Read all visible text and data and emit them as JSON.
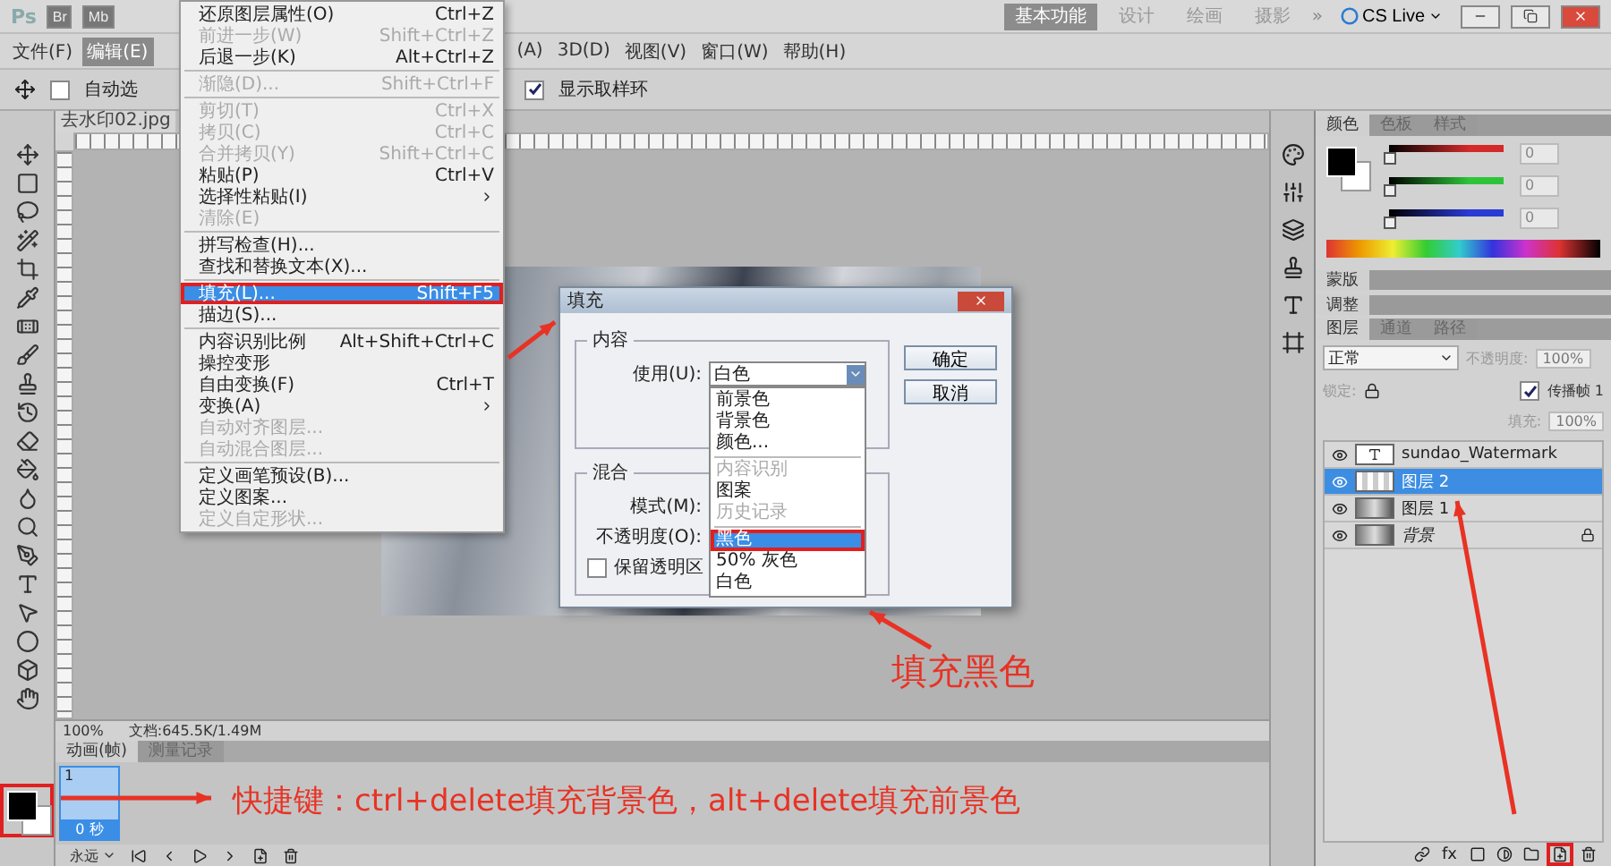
{
  "title_bar": {
    "logo": "Ps",
    "apps": [
      "Br",
      "Mb"
    ],
    "workspaces": [
      {
        "label": "基本功能",
        "selected": true
      },
      {
        "label": "设计",
        "selected": false
      },
      {
        "label": "绘画",
        "selected": false
      },
      {
        "label": "摄影",
        "selected": false
      }
    ],
    "more": "»",
    "cs_live": "CS Live"
  },
  "menu_bar": [
    {
      "label": "文件(F)",
      "selected": false
    },
    {
      "label": "编辑(E)",
      "selected": true
    },
    {
      "label": "(A)",
      "selected": false
    },
    {
      "label": "3D(D)",
      "selected": false
    },
    {
      "label": "视图(V)",
      "selected": false
    },
    {
      "label": "窗口(W)",
      "selected": false
    },
    {
      "label": "帮助(H)",
      "selected": false
    }
  ],
  "options_bar": {
    "auto_select": {
      "label": "自动选",
      "checked": false
    },
    "show_ring": {
      "label": "显示取样环",
      "checked": true
    }
  },
  "document": {
    "tab": "去水印02.jpg",
    "zoom": "100%",
    "doc_info": "文档:645.5K/1.49M"
  },
  "edit_menu": {
    "groups": [
      [
        {
          "label": "还原图层属性(O)",
          "shortcut": "Ctrl+Z",
          "disabled": false,
          "selected": false,
          "submenu": false
        },
        {
          "label": "前进一步(W)",
          "shortcut": "Shift+Ctrl+Z",
          "disabled": true,
          "selected": false,
          "submenu": false
        },
        {
          "label": "后退一步(K)",
          "shortcut": "Alt+Ctrl+Z",
          "disabled": false,
          "selected": false,
          "submenu": false
        }
      ],
      [
        {
          "label": "渐隐(D)...",
          "shortcut": "Shift+Ctrl+F",
          "disabled": true,
          "selected": false,
          "submenu": false
        }
      ],
      [
        {
          "label": "剪切(T)",
          "shortcut": "Ctrl+X",
          "disabled": true,
          "selected": false,
          "submenu": false
        },
        {
          "label": "拷贝(C)",
          "shortcut": "Ctrl+C",
          "disabled": true,
          "selected": false,
          "submenu": false
        },
        {
          "label": "合并拷贝(Y)",
          "shortcut": "Shift+Ctrl+C",
          "disabled": true,
          "selected": false,
          "submenu": false
        },
        {
          "label": "粘贴(P)",
          "shortcut": "Ctrl+V",
          "disabled": false,
          "selected": false,
          "submenu": false
        },
        {
          "label": "选择性粘贴(I)",
          "disabled": false,
          "selected": false,
          "submenu": true
        },
        {
          "label": "清除(E)",
          "disabled": true,
          "selected": false,
          "submenu": false
        }
      ],
      [
        {
          "label": "拼写检查(H)...",
          "disabled": false,
          "selected": false,
          "submenu": false
        },
        {
          "label": "查找和替换文本(X)...",
          "disabled": false,
          "selected": false,
          "submenu": false
        }
      ],
      [
        {
          "label": "填充(L)...",
          "shortcut": "Shift+F5",
          "disabled": false,
          "selected": true,
          "submenu": false
        },
        {
          "label": "描边(S)...",
          "disabled": false,
          "selected": false,
          "submenu": false
        }
      ],
      [
        {
          "label": "内容识别比例",
          "shortcut": "Alt+Shift+Ctrl+C",
          "disabled": false,
          "selected": false,
          "submenu": false
        },
        {
          "label": "操控变形",
          "disabled": false,
          "selected": false,
          "submenu": false
        },
        {
          "label": "自由变换(F)",
          "shortcut": "Ctrl+T",
          "disabled": false,
          "selected": false,
          "submenu": false
        },
        {
          "label": "变换(A)",
          "disabled": false,
          "selected": false,
          "submenu": true
        },
        {
          "label": "自动对齐图层...",
          "disabled": true,
          "selected": false,
          "submenu": false
        },
        {
          "label": "自动混合图层...",
          "disabled": true,
          "selected": false,
          "submenu": false
        }
      ],
      [
        {
          "label": "定义画笔预设(B)...",
          "disabled": false,
          "selected": false,
          "submenu": false
        },
        {
          "label": "定义图案...",
          "disabled": false,
          "selected": false,
          "submenu": false
        },
        {
          "label": "定义自定形状...",
          "disabled": true,
          "selected": false,
          "submenu": false
        }
      ]
    ]
  },
  "fill_dialog": {
    "title": "填充",
    "contents_label": "内容",
    "use_label": "使用(U):",
    "use_value": "白色",
    "options": [
      [
        {
          "label": "前景色",
          "disabled": false,
          "selected": false
        },
        {
          "label": "背景色",
          "disabled": false,
          "selected": false
        },
        {
          "label": "颜色...",
          "disabled": false,
          "selected": false
        }
      ],
      [
        {
          "label": "内容识别",
          "disabled": true,
          "selected": false
        },
        {
          "label": "图案",
          "disabled": false,
          "selected": false
        },
        {
          "label": "历史记录",
          "disabled": true,
          "selected": false
        }
      ],
      [
        {
          "label": "黑色",
          "disabled": false,
          "selected": true
        },
        {
          "label": "50% 灰色",
          "disabled": false,
          "selected": false
        },
        {
          "label": "白色",
          "disabled": false,
          "selected": false
        }
      ]
    ],
    "blend_label": "混合",
    "mode_label": "模式(M):",
    "opacity_label": "不透明度(O):",
    "preserve": {
      "label": "保留透明区",
      "checked": false
    },
    "buttons": [
      "确定",
      "取消"
    ]
  },
  "color_panel": {
    "tabs": [
      {
        "label": "颜色",
        "selected": true
      },
      {
        "label": "色板",
        "selected": false
      },
      {
        "label": "样式",
        "selected": false
      }
    ],
    "channels": [
      {
        "color": "#d42a2a",
        "level": 0,
        "value": "0"
      },
      {
        "color": "#2ec43a",
        "level": 0,
        "value": "0"
      },
      {
        "color": "#2a3ad4",
        "level": 0,
        "value": "0"
      }
    ]
  },
  "collapsed_panels": [
    "蒙版",
    "调整"
  ],
  "layers_panel": {
    "tabs": [
      {
        "label": "图层",
        "selected": true
      },
      {
        "label": "通道",
        "selected": false
      },
      {
        "label": "路径",
        "selected": false
      }
    ],
    "blend_mode": "正常",
    "opacity_label": "不透明度:",
    "opacity": "100%",
    "lock_label": "锁定:",
    "propagate": {
      "label": "传播帧 1",
      "checked": true
    },
    "fill_label": "填充:",
    "fill": "100%",
    "layers": [
      {
        "name": "sundao_Watermark",
        "kind": "text",
        "selected": false,
        "locked": false
      },
      {
        "name": "图层 2",
        "kind": "empty",
        "selected": true,
        "locked": false
      },
      {
        "name": "图层 1",
        "kind": "image",
        "selected": false,
        "locked": false
      },
      {
        "name": "背景",
        "kind": "image",
        "selected": false,
        "locked": true
      }
    ],
    "fx": "fx",
    "new_layer_highlighted": true
  },
  "toolbox": {
    "swatch_highlighted": true
  },
  "animation_panel": {
    "tabs": [
      {
        "label": "动画(帧)",
        "selected": true
      },
      {
        "label": "测量记录",
        "selected": false
      }
    ],
    "frames": [
      {
        "number": "1",
        "delay": "0 秒",
        "selected": true
      }
    ],
    "loop": "永远"
  },
  "annotations": {
    "fill_black": "填充黑色",
    "shortcut": "快捷键：ctrl+delete填充背景色，alt+delete填充前景色"
  }
}
